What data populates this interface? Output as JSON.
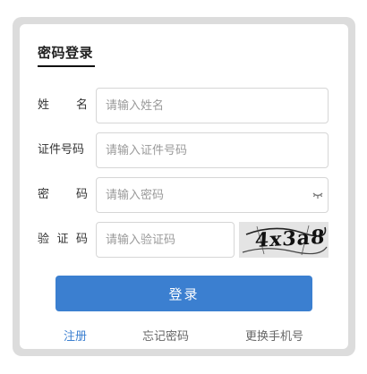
{
  "form": {
    "title": "密码登录",
    "name": {
      "label_chars": [
        "姓",
        "名"
      ],
      "placeholder": "请输入姓名"
    },
    "id_number": {
      "label": "证件号码",
      "placeholder": "请输入证件号码"
    },
    "password": {
      "label_chars": [
        "密",
        "码"
      ],
      "placeholder": "请输入密码",
      "toggle_icon": "eye-closed-icon"
    },
    "captcha": {
      "label_chars": [
        "验",
        "证",
        "码"
      ],
      "placeholder": "请输入验证码",
      "image_text": "4x3a8"
    },
    "login_button": "登录"
  },
  "links": {
    "register": "注册",
    "forgot_password": "忘记密码",
    "change_phone": "更换手机号"
  },
  "colors": {
    "accent": "#3b7fd0",
    "frame": "#dcdcdc"
  }
}
